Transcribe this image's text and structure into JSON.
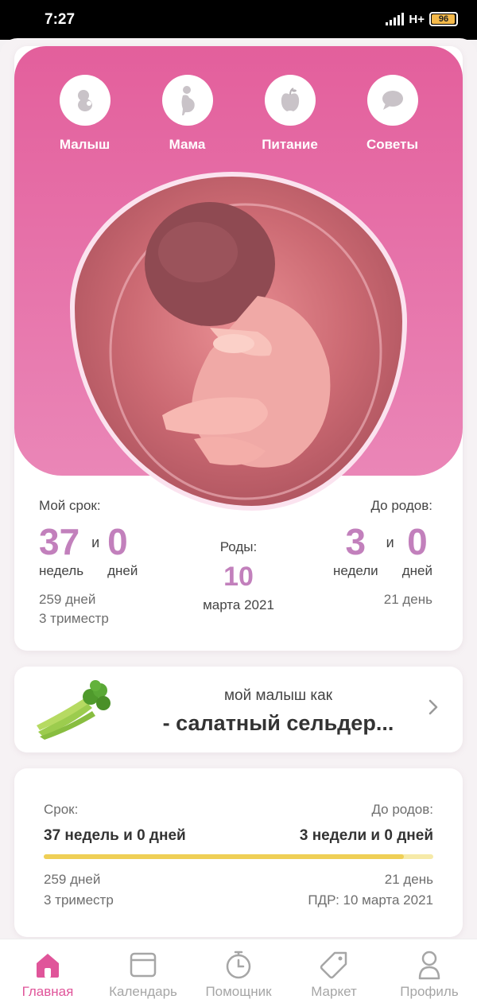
{
  "status_bar": {
    "time": "7:27",
    "network": "H+",
    "battery": "96",
    "battery_level": 0.96
  },
  "categories": [
    {
      "label": "Малыш",
      "icon": "baby-icon"
    },
    {
      "label": "Мама",
      "icon": "pregnant-mom-icon"
    },
    {
      "label": "Питание",
      "icon": "apple-icon"
    },
    {
      "label": "Советы",
      "icon": "chat-bubble-icon"
    }
  ],
  "term": {
    "label": "Мой срок:",
    "weeks": "37",
    "weeks_unit": "недель",
    "and": "и",
    "days": "0",
    "days_unit": "дней",
    "total_days": "259 дней",
    "trimester": "3 триместр"
  },
  "birth": {
    "label": "Роды:",
    "day": "10",
    "month_year": "марта 2021"
  },
  "until_birth": {
    "label": "До родов:",
    "weeks": "3",
    "weeks_unit": "недели",
    "and": "и",
    "days": "0",
    "days_unit": "дней",
    "total_days": "21 день"
  },
  "comparison": {
    "intro": "мой малыш как",
    "item": "- салатный сельдер..."
  },
  "progress": {
    "left_label": "Срок:",
    "right_label": "До родов:",
    "left_value": "37 недель и 0 дней",
    "right_value": "3 недели и 0 дней",
    "fraction": 0.925,
    "left_days": "259 дней",
    "right_days": "21 день",
    "trimester": "3 триместр",
    "due_date": "ПДР: 10 марта 2021"
  },
  "tabs": [
    {
      "label": "Главная",
      "icon": "home-icon",
      "active": true
    },
    {
      "label": "Календарь",
      "icon": "calendar-icon",
      "active": false
    },
    {
      "label": "Помощник",
      "icon": "stopwatch-icon",
      "active": false
    },
    {
      "label": "Маркет",
      "icon": "tag-icon",
      "active": false
    },
    {
      "label": "Профиль",
      "icon": "profile-icon",
      "active": false
    }
  ],
  "colors": {
    "accent": "#e0559a",
    "pink_top": "#e35f9c",
    "number": "#c280bc",
    "progress": "#efcf56"
  }
}
